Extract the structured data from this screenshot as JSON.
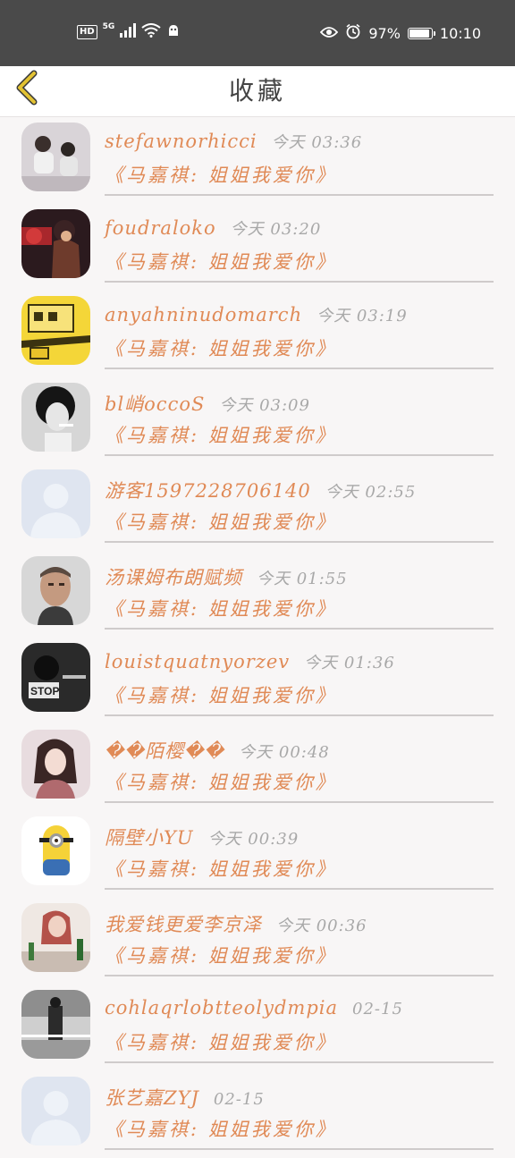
{
  "status_bar": {
    "hd": "HD",
    "network": "5G",
    "battery_text": "97%",
    "battery_level": 0.97,
    "time": "10:10"
  },
  "header": {
    "title": "收藏"
  },
  "colors": {
    "accent": "#e08a56",
    "time_gray": "#a8a8a8",
    "back_arrow": "#e2c233"
  },
  "favorites": [
    {
      "user": "stefawnorhicci",
      "time": "今天 03:36",
      "text": "《马嘉祺: 姐姐我爱你》",
      "avatar": "photo-two-people"
    },
    {
      "user": "foudraloko",
      "time": "今天 03:20",
      "text": "《马嘉祺: 姐姐我爱你》",
      "avatar": "game-character"
    },
    {
      "user": "anyahninudomarch",
      "time": "今天 03:19",
      "text": "《马嘉祺: 姐姐我爱你》",
      "avatar": "yellow-cartoon"
    },
    {
      "user": "bl峭occoS",
      "time": "今天 03:09",
      "text": "《马嘉祺: 姐姐我爱你》",
      "avatar": "bw-portrait"
    },
    {
      "user": "游客1597228706140",
      "time": "今天 02:55",
      "text": "《马嘉祺: 姐姐我爱你》",
      "avatar": "default-silhouette"
    },
    {
      "user": "汤课姆布朗赋频",
      "time": "今天 01:55",
      "text": "《马嘉祺: 姐姐我爱你》",
      "avatar": "man-portrait"
    },
    {
      "user": "louistquatnyorzev",
      "time": "今天 01:36",
      "text": "《马嘉祺: 姐姐我爱你》",
      "avatar": "bw-stop"
    },
    {
      "user": "��陌樱��",
      "time": "今天 00:48",
      "text": "《马嘉祺: 姐姐我爱你》",
      "avatar": "girl-photo"
    },
    {
      "user": "隔壁小YU",
      "time": "今天 00:39",
      "text": "《马嘉祺: 姐姐我爱你》",
      "avatar": "minion"
    },
    {
      "user": "我爱钱更爱李京泽",
      "time": "今天 00:36",
      "text": "《马嘉祺: 姐姐我爱你》",
      "avatar": "girl-drinks"
    },
    {
      "user": "cohlaqrlobtteolydmpia",
      "time": "02-15",
      "text": "《马嘉祺: 姐姐我爱你》",
      "avatar": "bw-street"
    },
    {
      "user": "张艺嘉ZYJ",
      "time": "02-15",
      "text": "《马嘉祺: 姐姐我爱你》",
      "avatar": "default-silhouette"
    }
  ]
}
